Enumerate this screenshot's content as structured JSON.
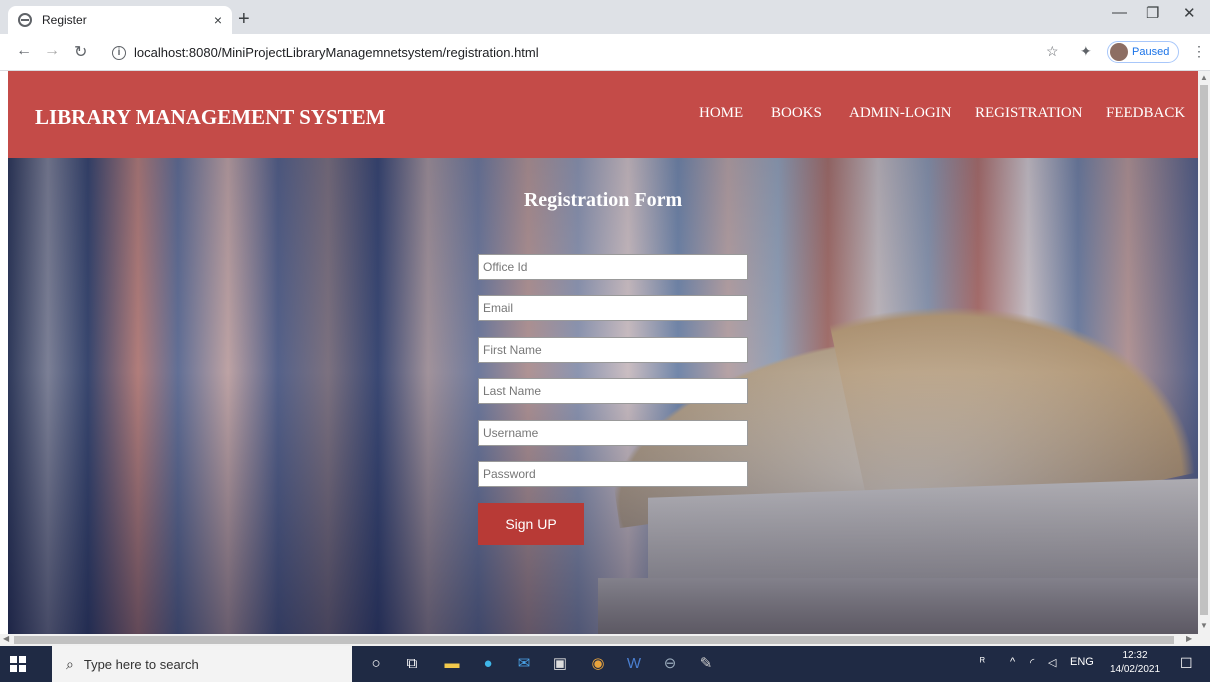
{
  "browser": {
    "tab_title": "Register",
    "tab_close": "×",
    "new_tab": "+",
    "url": "localhost:8080/MiniProjectLibraryManagemnetsystem/registration.html",
    "profile_status": "Paused"
  },
  "site": {
    "title": "LIBRARY MANAGEMENT SYSTEM",
    "nav": [
      "HOME",
      "BOOKS",
      "ADMIN-LOGIN",
      "REGISTRATION",
      "FEEDBACK"
    ],
    "header_color": "#c44b48"
  },
  "form": {
    "title": "Registration Form",
    "fields": {
      "office_id": "Office Id",
      "email": "Email",
      "first_name": "First Name",
      "last_name": "Last Name",
      "username": "Username",
      "password": "Password"
    },
    "submit_label": "Sign UP",
    "button_color": "#b83a36"
  },
  "taskbar": {
    "search_placeholder": "Type here to search",
    "language": "ENG",
    "time": "12:32",
    "date": "14/02/2021"
  }
}
